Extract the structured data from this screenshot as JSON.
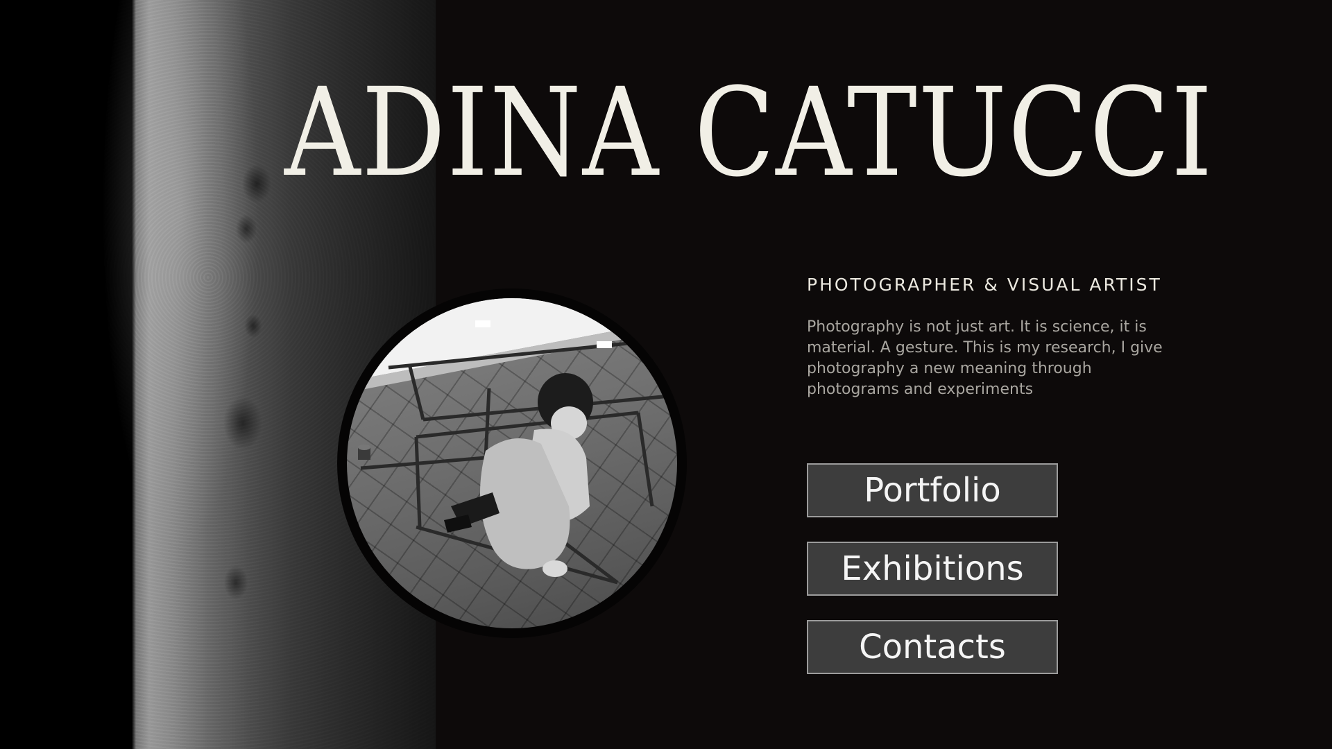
{
  "hero": {
    "name": "ADINA CATUCCI",
    "role": "PHOTOGRAPHER & VISUAL ARTIST",
    "bio": "Photography is not just art. It is science, it is material. A gesture. This is my research, I give photography a new meaning through photograms and experiments"
  },
  "nav": {
    "items": [
      {
        "label": "Portfolio"
      },
      {
        "label": "Exhibitions"
      },
      {
        "label": "Contacts"
      }
    ]
  },
  "colors": {
    "background": "#0d0a0a",
    "title": "#f1efe6",
    "button_fill": "#3d3d3d",
    "button_border": "#9c9c9c"
  }
}
